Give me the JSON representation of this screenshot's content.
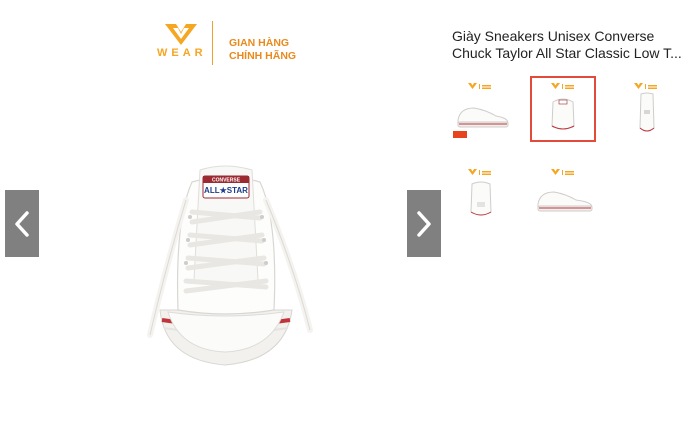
{
  "brand": {
    "name": "WEAR",
    "tagline_line1": "GIAN HÀNG",
    "tagline_line2": "CHÍNH HÃNG",
    "color": "#f5a623"
  },
  "product": {
    "title_line1": "Giày Sneakers Unisex Converse",
    "title_line2": "Chuck Taylor All Star Classic Low T..."
  },
  "shoe_label": {
    "top": "CONVERSE",
    "bottom": "ALL★STAR"
  },
  "navigation": {
    "prev_icon": "chevron-left-icon",
    "next_icon": "chevron-right-icon"
  },
  "thumbnails": [
    {
      "view": "side",
      "active": false
    },
    {
      "view": "front",
      "active": true
    },
    {
      "view": "back",
      "active": false
    },
    {
      "view": "heel",
      "active": false
    },
    {
      "view": "pair-side",
      "active": false
    }
  ],
  "colors": {
    "active_border": "#e24a3b",
    "arrow_bg": "#808080"
  }
}
